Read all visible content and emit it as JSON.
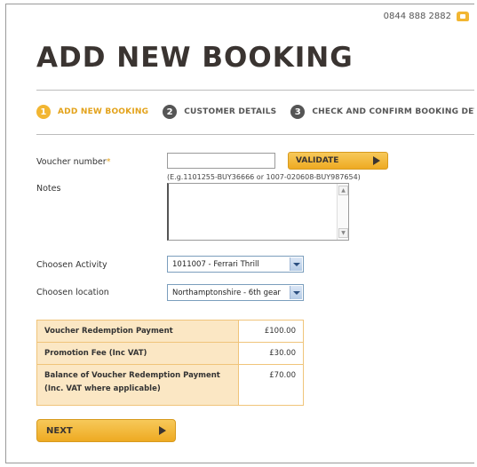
{
  "header": {
    "phone": "0844 888 2882",
    "phone_icon": "phone-icon",
    "accent": "#f2b632"
  },
  "page_title": "ADD NEW BOOKING",
  "steps": [
    {
      "num": "1",
      "label": "ADD NEW BOOKING",
      "active": true
    },
    {
      "num": "2",
      "label": "CUSTOMER DETAILS"
    },
    {
      "num": "3",
      "label": "CHECK AND CONFIRM BOOKING DETAI"
    }
  ],
  "form": {
    "voucher_label": "Voucher number",
    "voucher_required": "*",
    "voucher_value": "",
    "validate_label": "VALIDATE",
    "voucher_hint": "(E.g.1101255-BUY36666 or 1007-020608-BUY987654)",
    "notes_label": "Notes",
    "notes_value": "",
    "activity_label": "Choosen Activity",
    "activity_value": "1011007 - Ferrari Thrill",
    "location_label": "Choosen location",
    "location_value": "Northamptonshire - 6th gear"
  },
  "payments": [
    {
      "label": "Voucher Redemption Payment",
      "value": "£100.00"
    },
    {
      "label": "Promotion Fee (Inc VAT)",
      "value": "£30.00"
    },
    {
      "label": "Balance of Voucher Redemption Payment",
      "label2": "(Inc. VAT where applicable)",
      "value": "£70.00"
    }
  ],
  "next_label": "NEXT"
}
